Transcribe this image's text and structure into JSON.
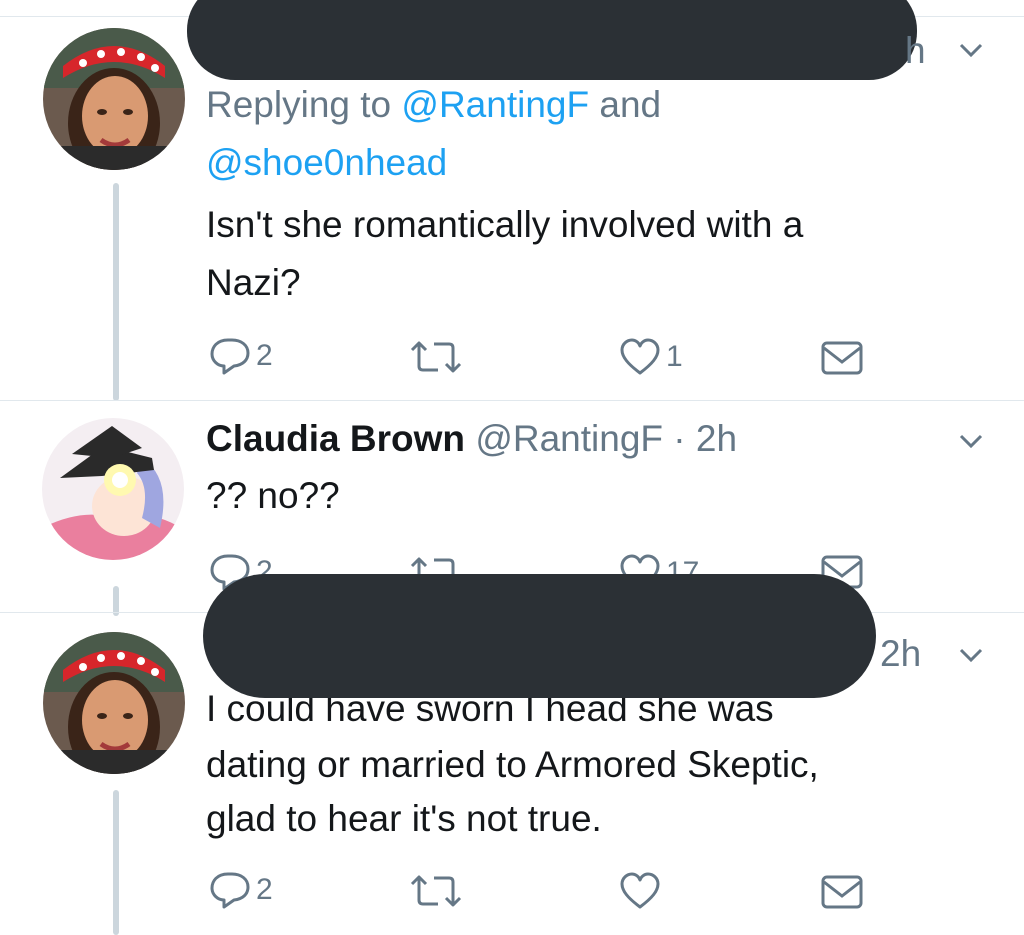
{
  "tweets": [
    {
      "time": "h",
      "reply_prefix": "Replying to ",
      "reply_mention_1": "@RantingF",
      "reply_conj": " and",
      "reply_mention_2": "@shoe0nhead",
      "text_line_1": "Isn't she romantically involved with a",
      "text_line_2": "Nazi?",
      "reply_count": "2",
      "like_count": "1"
    },
    {
      "name": "Claudia Brown",
      "handle": "@RantingF",
      "time_sep": " · ",
      "time": "2h",
      "text": "?? no??",
      "reply_count": "2",
      "like_count": "17"
    },
    {
      "time": "2h",
      "text_line_1": "I could have sworn I head she was",
      "text_line_2": "dating or married to Armored Skeptic,",
      "text_line_3": "glad to hear it's not true.",
      "reply_count": "2",
      "like_count": ""
    }
  ],
  "colors": {
    "link": "#1da1f2",
    "muted": "#657786",
    "thread_line": "#ccd6dd",
    "redaction": "#2b3035"
  },
  "icons": [
    "reply-icon",
    "retweet-icon",
    "like-icon",
    "dm-icon",
    "chevron-down-icon"
  ]
}
